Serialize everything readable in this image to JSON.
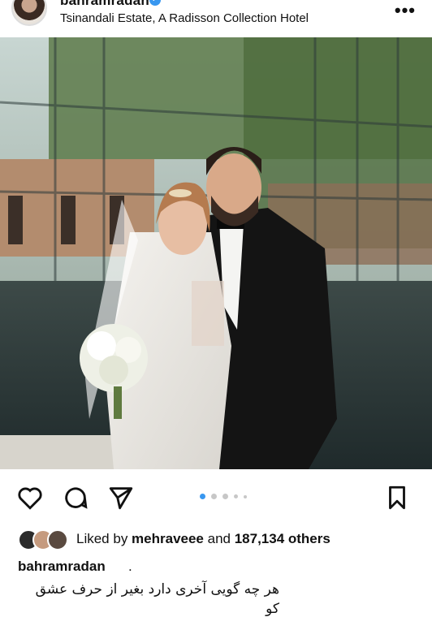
{
  "post": {
    "username": "bahramradan",
    "location": "Tsinandali Estate, A Radisson Collection Hotel",
    "verified_icon": "check-badge-icon",
    "more_icon": "more-horizontal-icon"
  },
  "media": {
    "description_icon": "wedding-photo",
    "carousel_total": 5,
    "carousel_active": 1
  },
  "actions": {
    "like_icon": "heart-icon",
    "comment_icon": "comment-icon",
    "share_icon": "paper-plane-icon",
    "save_icon": "bookmark-icon"
  },
  "likes": {
    "prefix": "Liked by ",
    "user": "mehraveee",
    "middle": " and ",
    "count": "187,134 others"
  },
  "caption": {
    "username": "bahramradan",
    "trailing": ".",
    "line1": "هر چه گویی آخری دارد بغیر از حرف عشق",
    "line2": "کو"
  },
  "colors": {
    "accent": "#3897f0",
    "text": "#111111",
    "dot_inactive": "#c7c7c7"
  }
}
